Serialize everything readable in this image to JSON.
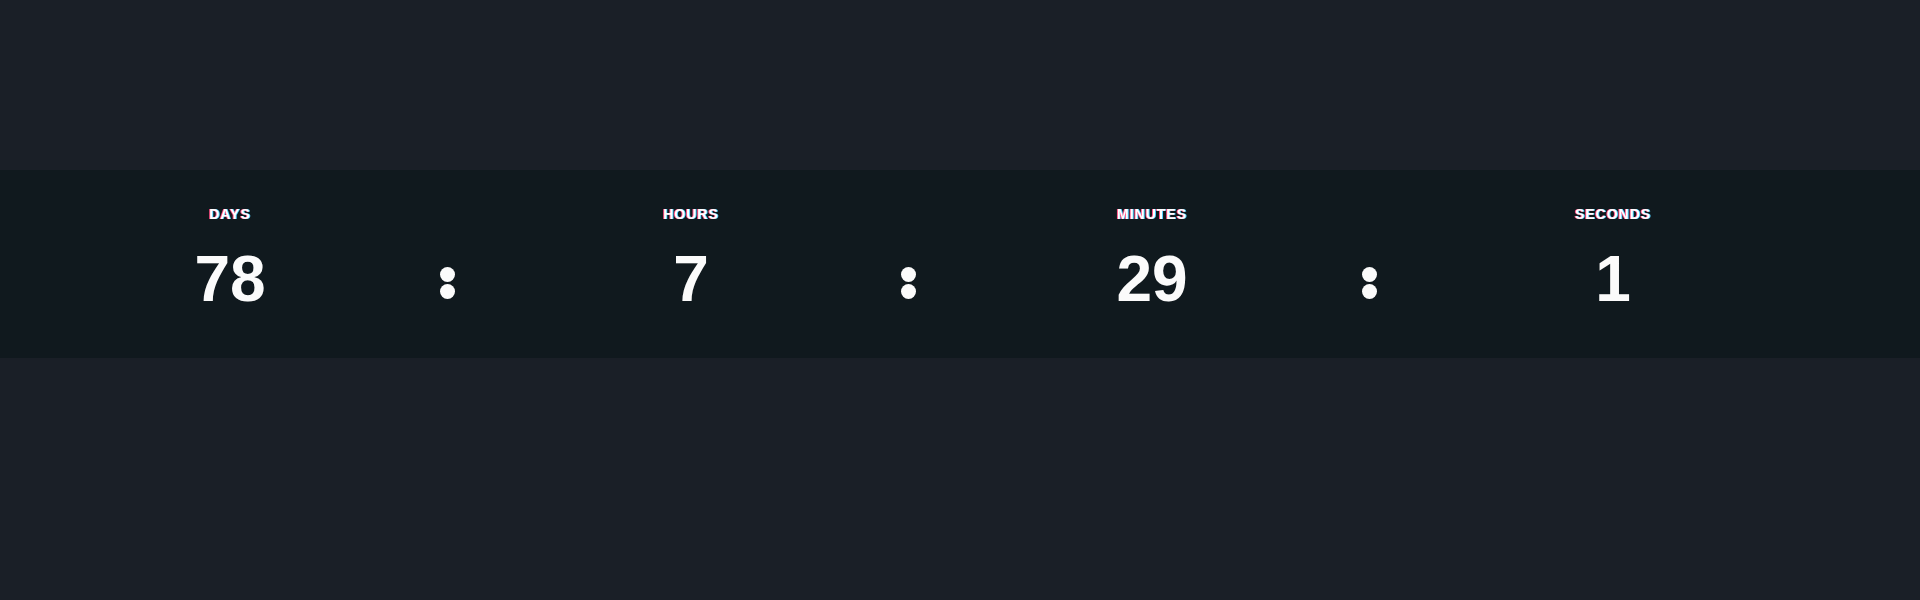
{
  "countdown": {
    "units": [
      {
        "label": "DAYS",
        "value": "78"
      },
      {
        "label": "HOURS",
        "value": "7"
      },
      {
        "label": "MINUTES",
        "value": "29"
      },
      {
        "label": "SECONDS",
        "value": "1"
      }
    ]
  }
}
